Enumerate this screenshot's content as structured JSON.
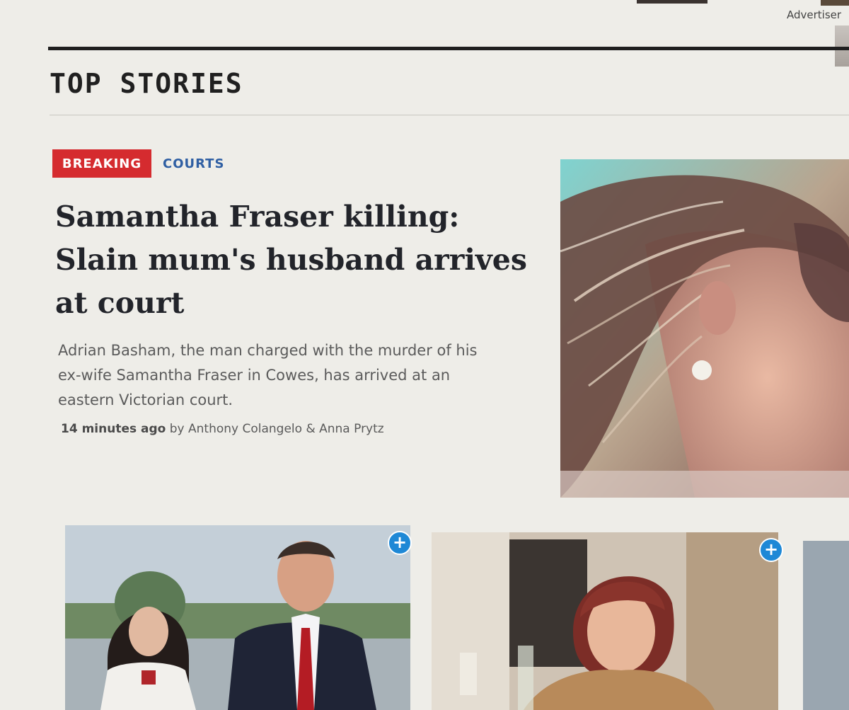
{
  "ad": {
    "label": "Advertiser"
  },
  "section": {
    "title": "TOP STORIES"
  },
  "lead_story": {
    "badge": "BREAKING",
    "category": "COURTS",
    "headline_lines": [
      "Samantha Fraser killing:",
      "Slain mum's husband arrives",
      "at court"
    ],
    "summary_lines": [
      "Adrian Basham, the man charged with the murder of his",
      "ex-wife Samantha Fraser in Cowes, has arrived at an",
      "eastern Victorian court."
    ],
    "time": "14 minutes ago",
    "byline": "by Anthony Colangelo & Anna Prytz"
  },
  "cards": [
    {
      "add_label": "+"
    },
    {
      "add_label": "+"
    }
  ],
  "colors": {
    "breaking_bg": "#d52b2f",
    "category_text": "#2f5fa3",
    "add_button": "#1e88d6",
    "rule": "#1f1f1f"
  },
  "icons": {
    "add": "plus-icon"
  }
}
